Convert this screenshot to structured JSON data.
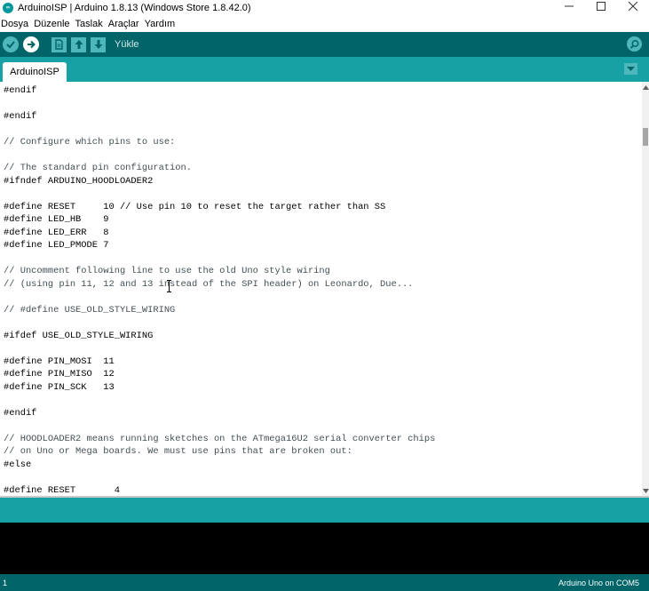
{
  "window": {
    "title": "ArduinoISP | Arduino 1.8.13 (Windows Store 1.8.42.0)",
    "icon_label": "∞"
  },
  "menu": [
    "Dosya",
    "Düzenle",
    "Taslak",
    "Araçlar",
    "Yardım"
  ],
  "toolbar": {
    "hover_label": "Yükle",
    "buttons": [
      "verify-icon",
      "upload-icon",
      "new-icon",
      "open-icon",
      "save-icon"
    ],
    "serial_monitor_icon": "magnifier-icon"
  },
  "tabs": [
    {
      "label": "ArduinoISP"
    }
  ],
  "code_lines": [
    {
      "text": "#endif",
      "kind": "kw"
    },
    {
      "text": "",
      "kind": "plain"
    },
    {
      "text": "#endif",
      "kind": "kw"
    },
    {
      "text": "",
      "kind": "plain"
    },
    {
      "text": "// Configure which pins to use:",
      "kind": "comment"
    },
    {
      "text": "",
      "kind": "plain"
    },
    {
      "text": "// The standard pin configuration.",
      "kind": "comment"
    },
    {
      "text": "#ifndef ARDUINO_HOODLOADER2",
      "kind": "kw"
    },
    {
      "text": "",
      "kind": "plain"
    },
    {
      "text": "#define RESET     10 // Use pin 10 to reset the target rather than SS",
      "kind": "kw"
    },
    {
      "text": "#define LED_HB    9",
      "kind": "kw"
    },
    {
      "text": "#define LED_ERR   8",
      "kind": "kw"
    },
    {
      "text": "#define LED_PMODE 7",
      "kind": "kw"
    },
    {
      "text": "",
      "kind": "plain"
    },
    {
      "text": "// Uncomment following line to use the old Uno style wiring",
      "kind": "comment"
    },
    {
      "text": "// (using pin 11, 12 and 13 instead of the SPI header) on Leonardo, Due...",
      "kind": "comment"
    },
    {
      "text": "",
      "kind": "plain"
    },
    {
      "text": "// #define USE_OLD_STYLE_WIRING",
      "kind": "comment"
    },
    {
      "text": "",
      "kind": "plain"
    },
    {
      "text": "#ifdef USE_OLD_STYLE_WIRING",
      "kind": "kw"
    },
    {
      "text": "",
      "kind": "plain"
    },
    {
      "text": "#define PIN_MOSI  11",
      "kind": "kw"
    },
    {
      "text": "#define PIN_MISO  12",
      "kind": "kw"
    },
    {
      "text": "#define PIN_SCK   13",
      "kind": "kw"
    },
    {
      "text": "",
      "kind": "plain"
    },
    {
      "text": "#endif",
      "kind": "kw"
    },
    {
      "text": "",
      "kind": "plain"
    },
    {
      "text": "// HOODLOADER2 means running sketches on the ATmega16U2 serial converter chips",
      "kind": "comment"
    },
    {
      "text": "// on Uno or Mega boards. We must use pins that are broken out:",
      "kind": "comment"
    },
    {
      "text": "#else",
      "kind": "kw"
    },
    {
      "text": "",
      "kind": "plain"
    },
    {
      "text": "#define RESET       4",
      "kind": "kw"
    }
  ],
  "status": {
    "line_number": "1",
    "board": "Arduino Uno on COM5"
  },
  "colors": {
    "toolbar_bg": "#006468",
    "tabbar_bg": "#17a1a5",
    "button_bg": "#4db7bb",
    "console_bg": "#000000"
  }
}
